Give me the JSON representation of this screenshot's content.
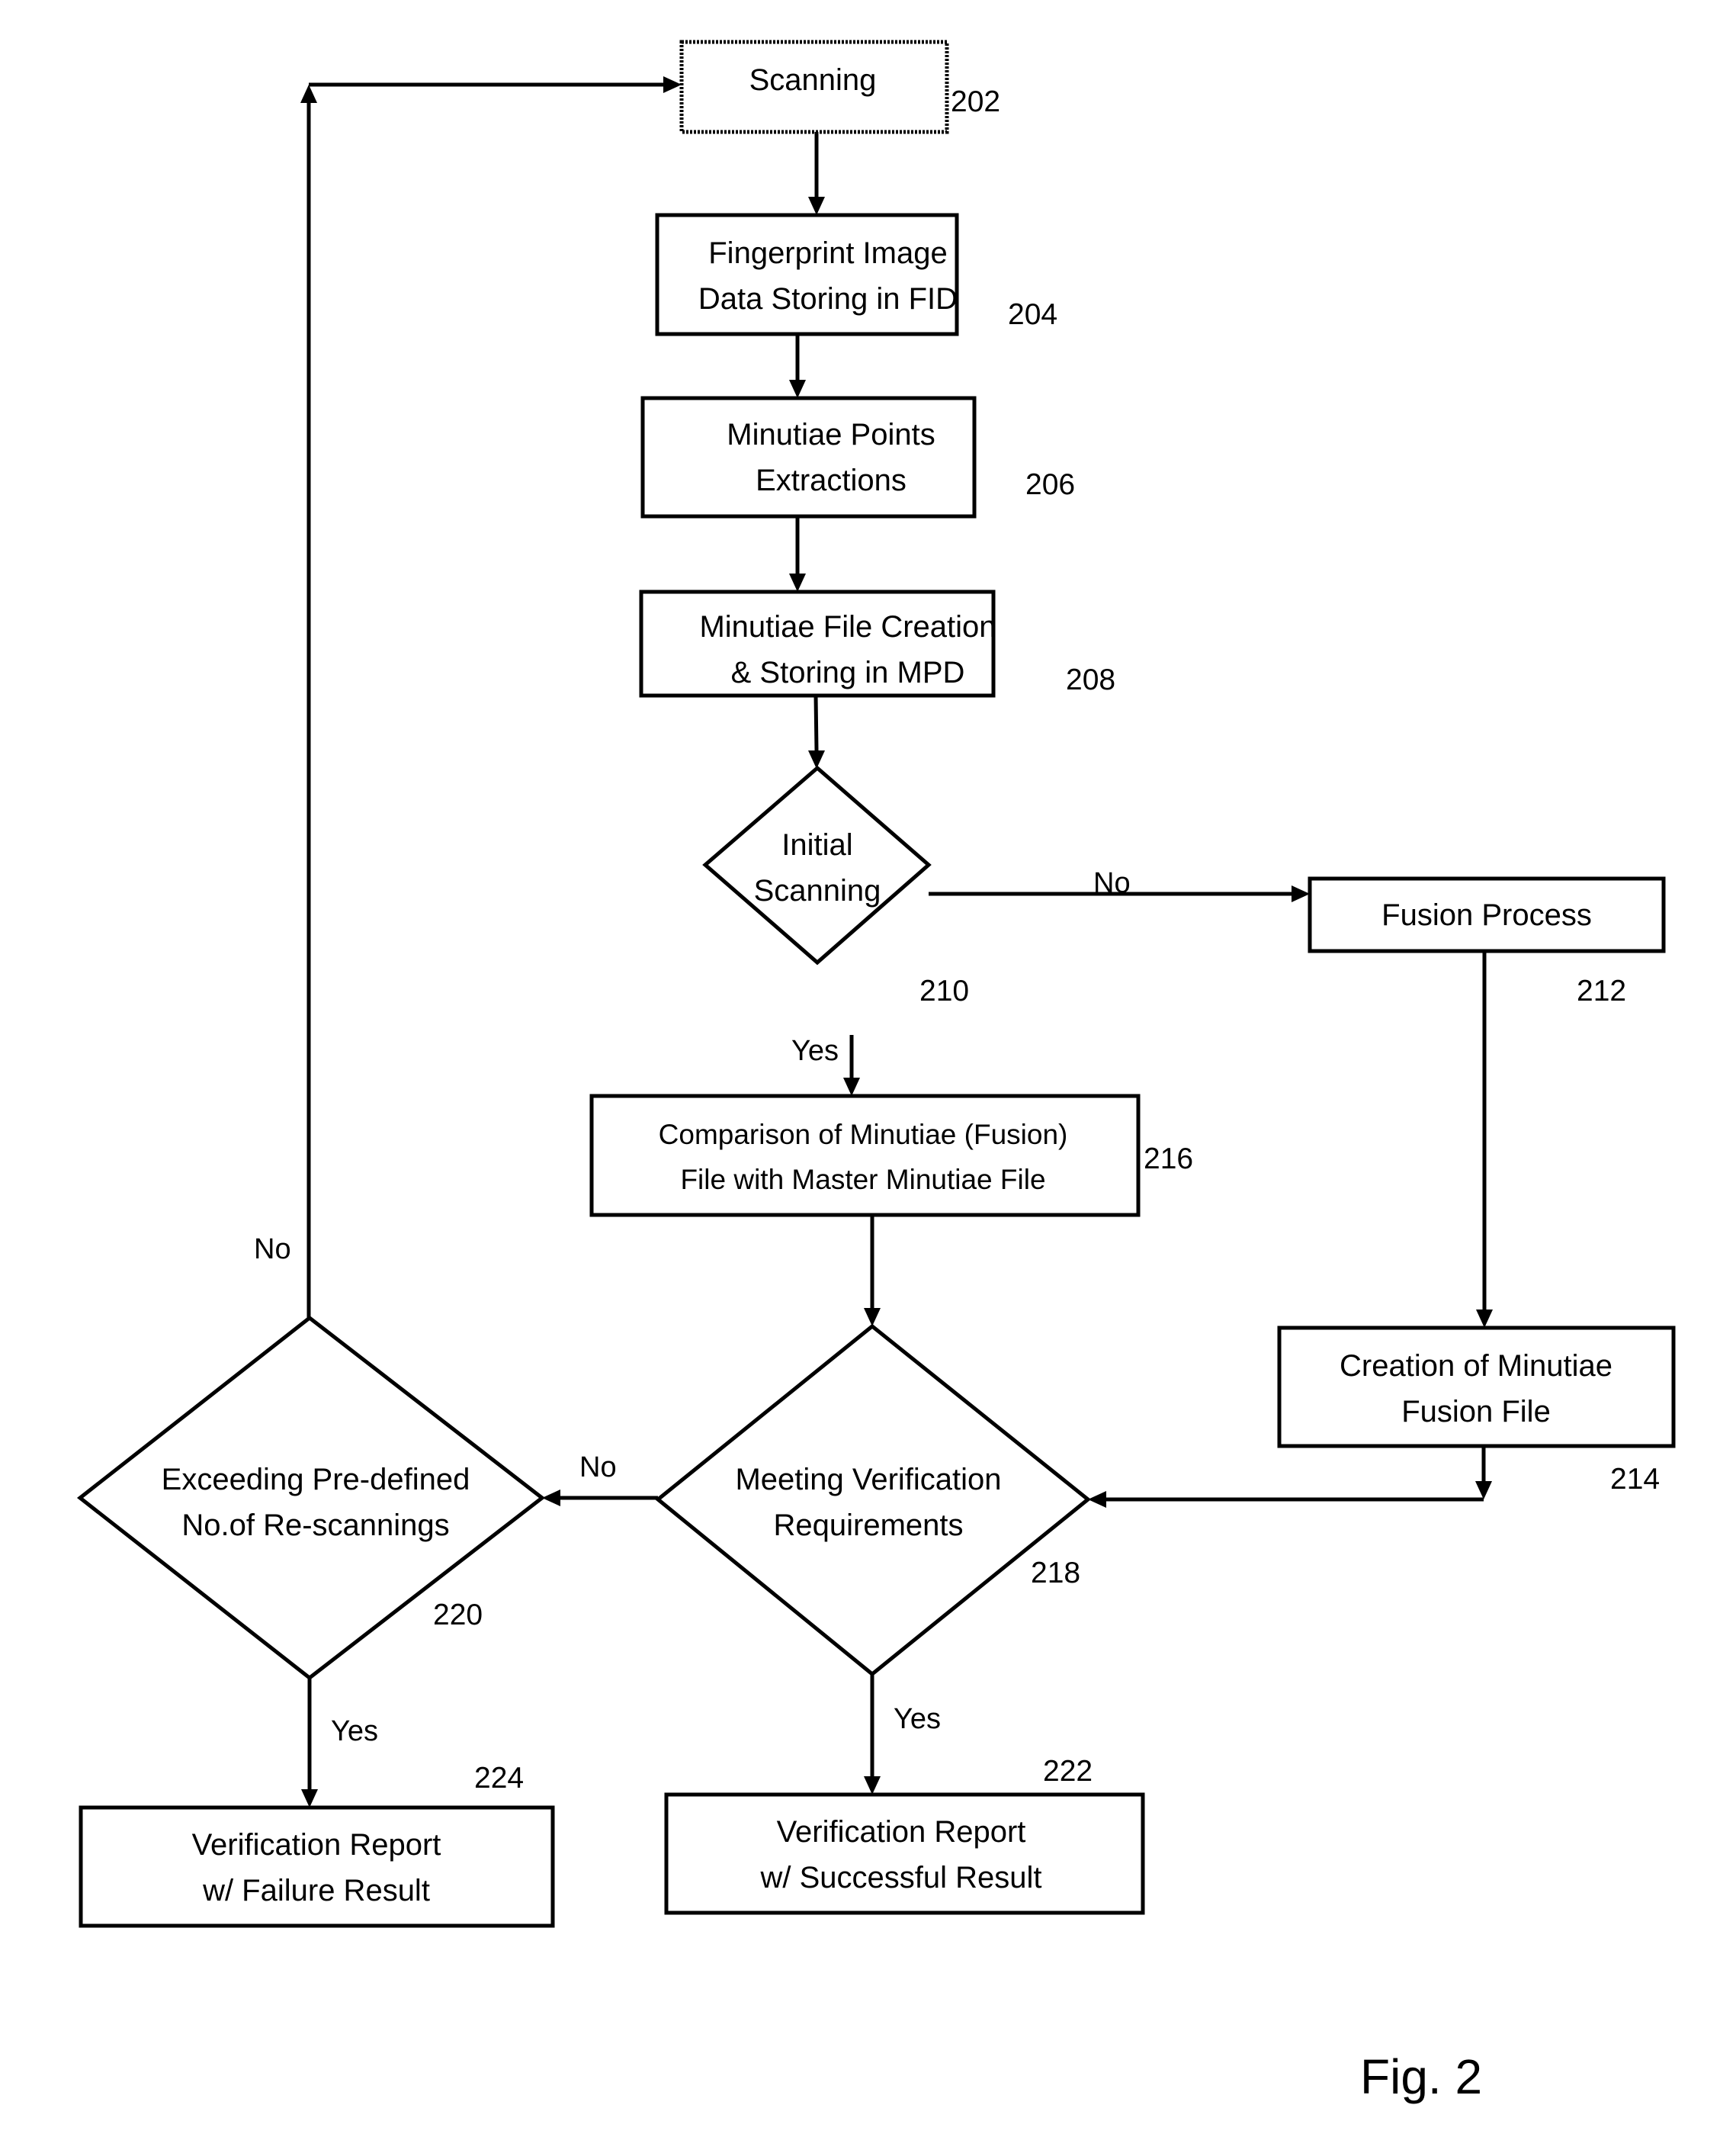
{
  "figure_label": "Fig. 2",
  "nodes": [
    {
      "id": "n202",
      "type": "process",
      "style": "dotted",
      "lines": [
        "Scanning"
      ],
      "ref": "202"
    },
    {
      "id": "n204",
      "type": "process",
      "lines": [
        "Fingerprint Image",
        "Data Storing in FID"
      ],
      "ref": "204"
    },
    {
      "id": "n206",
      "type": "process",
      "lines": [
        "Minutiae Points",
        "Extractions"
      ],
      "ref": "206"
    },
    {
      "id": "n208",
      "type": "process",
      "lines": [
        "Minutiae File Creation",
        "& Storing in MPD"
      ],
      "ref": "208"
    },
    {
      "id": "n210",
      "type": "decision",
      "lines": [
        "Initial",
        "Scanning"
      ],
      "ref": "210"
    },
    {
      "id": "n212",
      "type": "process",
      "lines": [
        "Fusion Process"
      ],
      "ref": "212"
    },
    {
      "id": "n214",
      "type": "process",
      "lines": [
        "Creation of Minutiae",
        "Fusion File"
      ],
      "ref": "214"
    },
    {
      "id": "n216",
      "type": "process",
      "lines": [
        "Comparison of Minutiae (Fusion)",
        "File with Master Minutiae File"
      ],
      "ref": "216"
    },
    {
      "id": "n218",
      "type": "decision",
      "lines": [
        "Meeting Verification",
        "Requirements"
      ],
      "ref": "218"
    },
    {
      "id": "n220",
      "type": "decision",
      "lines": [
        "Exceeding Pre-defined",
        "No.of Re-scannings"
      ],
      "ref": "220"
    },
    {
      "id": "n222",
      "type": "process",
      "lines": [
        "Verification Report",
        "w/ Successful Result"
      ],
      "ref": "222"
    },
    {
      "id": "n224",
      "type": "process",
      "lines": [
        "Verification Report",
        "w/ Failure Result"
      ],
      "ref": "224"
    }
  ],
  "edges": [
    {
      "from": "n202",
      "to": "n204",
      "label": ""
    },
    {
      "from": "n204",
      "to": "n206",
      "label": ""
    },
    {
      "from": "n206",
      "to": "n208",
      "label": ""
    },
    {
      "from": "n208",
      "to": "n210",
      "label": ""
    },
    {
      "from": "n210",
      "to": "n212",
      "label": "No"
    },
    {
      "from": "n210",
      "to": "n216",
      "label": "Yes"
    },
    {
      "from": "n212",
      "to": "n214",
      "label": ""
    },
    {
      "from": "n214",
      "to": "n218",
      "label": ""
    },
    {
      "from": "n216",
      "to": "n218",
      "label": ""
    },
    {
      "from": "n218",
      "to": "n220",
      "label": "No"
    },
    {
      "from": "n218",
      "to": "n222",
      "label": "Yes"
    },
    {
      "from": "n220",
      "to": "n224",
      "label": "Yes"
    },
    {
      "from": "n220",
      "to": "n202",
      "label": "No"
    }
  ]
}
